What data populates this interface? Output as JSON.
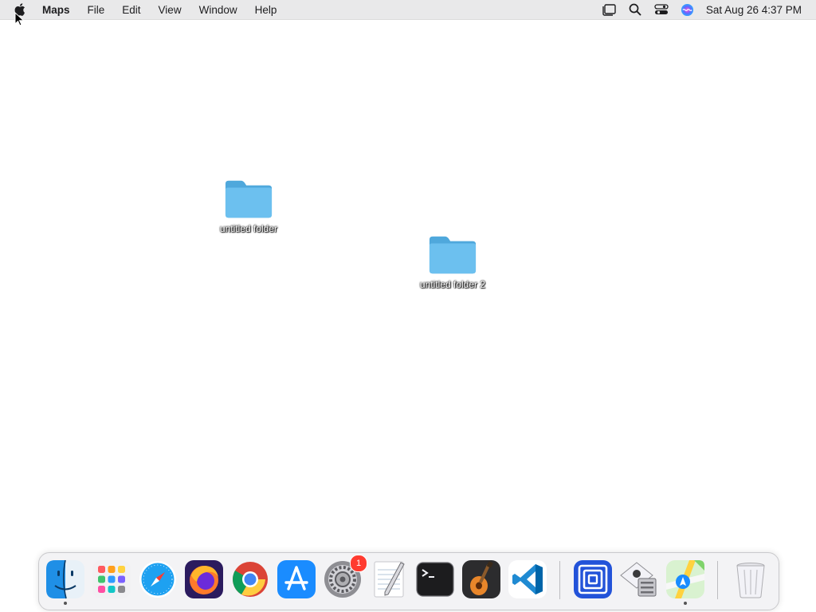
{
  "menubar": {
    "app_name": "Maps",
    "items": [
      "File",
      "Edit",
      "View",
      "Window",
      "Help"
    ],
    "clock": "Sat Aug 26  4:37 PM"
  },
  "desktop": {
    "folders": [
      {
        "label": "untitled folder"
      },
      {
        "label": "untitled folder 2"
      }
    ]
  },
  "dock": {
    "apps": [
      {
        "name": "finder-icon",
        "running": true
      },
      {
        "name": "launchpad-icon"
      },
      {
        "name": "safari-icon"
      },
      {
        "name": "firefox-icon"
      },
      {
        "name": "chrome-icon"
      },
      {
        "name": "app-store-icon"
      },
      {
        "name": "system-settings-icon",
        "badge": "1"
      },
      {
        "name": "textedit-icon"
      },
      {
        "name": "terminal-icon"
      },
      {
        "name": "garageband-icon"
      },
      {
        "name": "vscode-icon"
      },
      {
        "name": "screen-sharing-icon"
      },
      {
        "name": "migration-assistant-icon"
      },
      {
        "name": "maps-icon",
        "running": true
      },
      {
        "name": "trash-icon"
      }
    ]
  },
  "colors": {
    "menubar_bg": "#e9e9ea",
    "folder_blue": "#6cc0ef",
    "badge_red": "#ff3b30"
  }
}
